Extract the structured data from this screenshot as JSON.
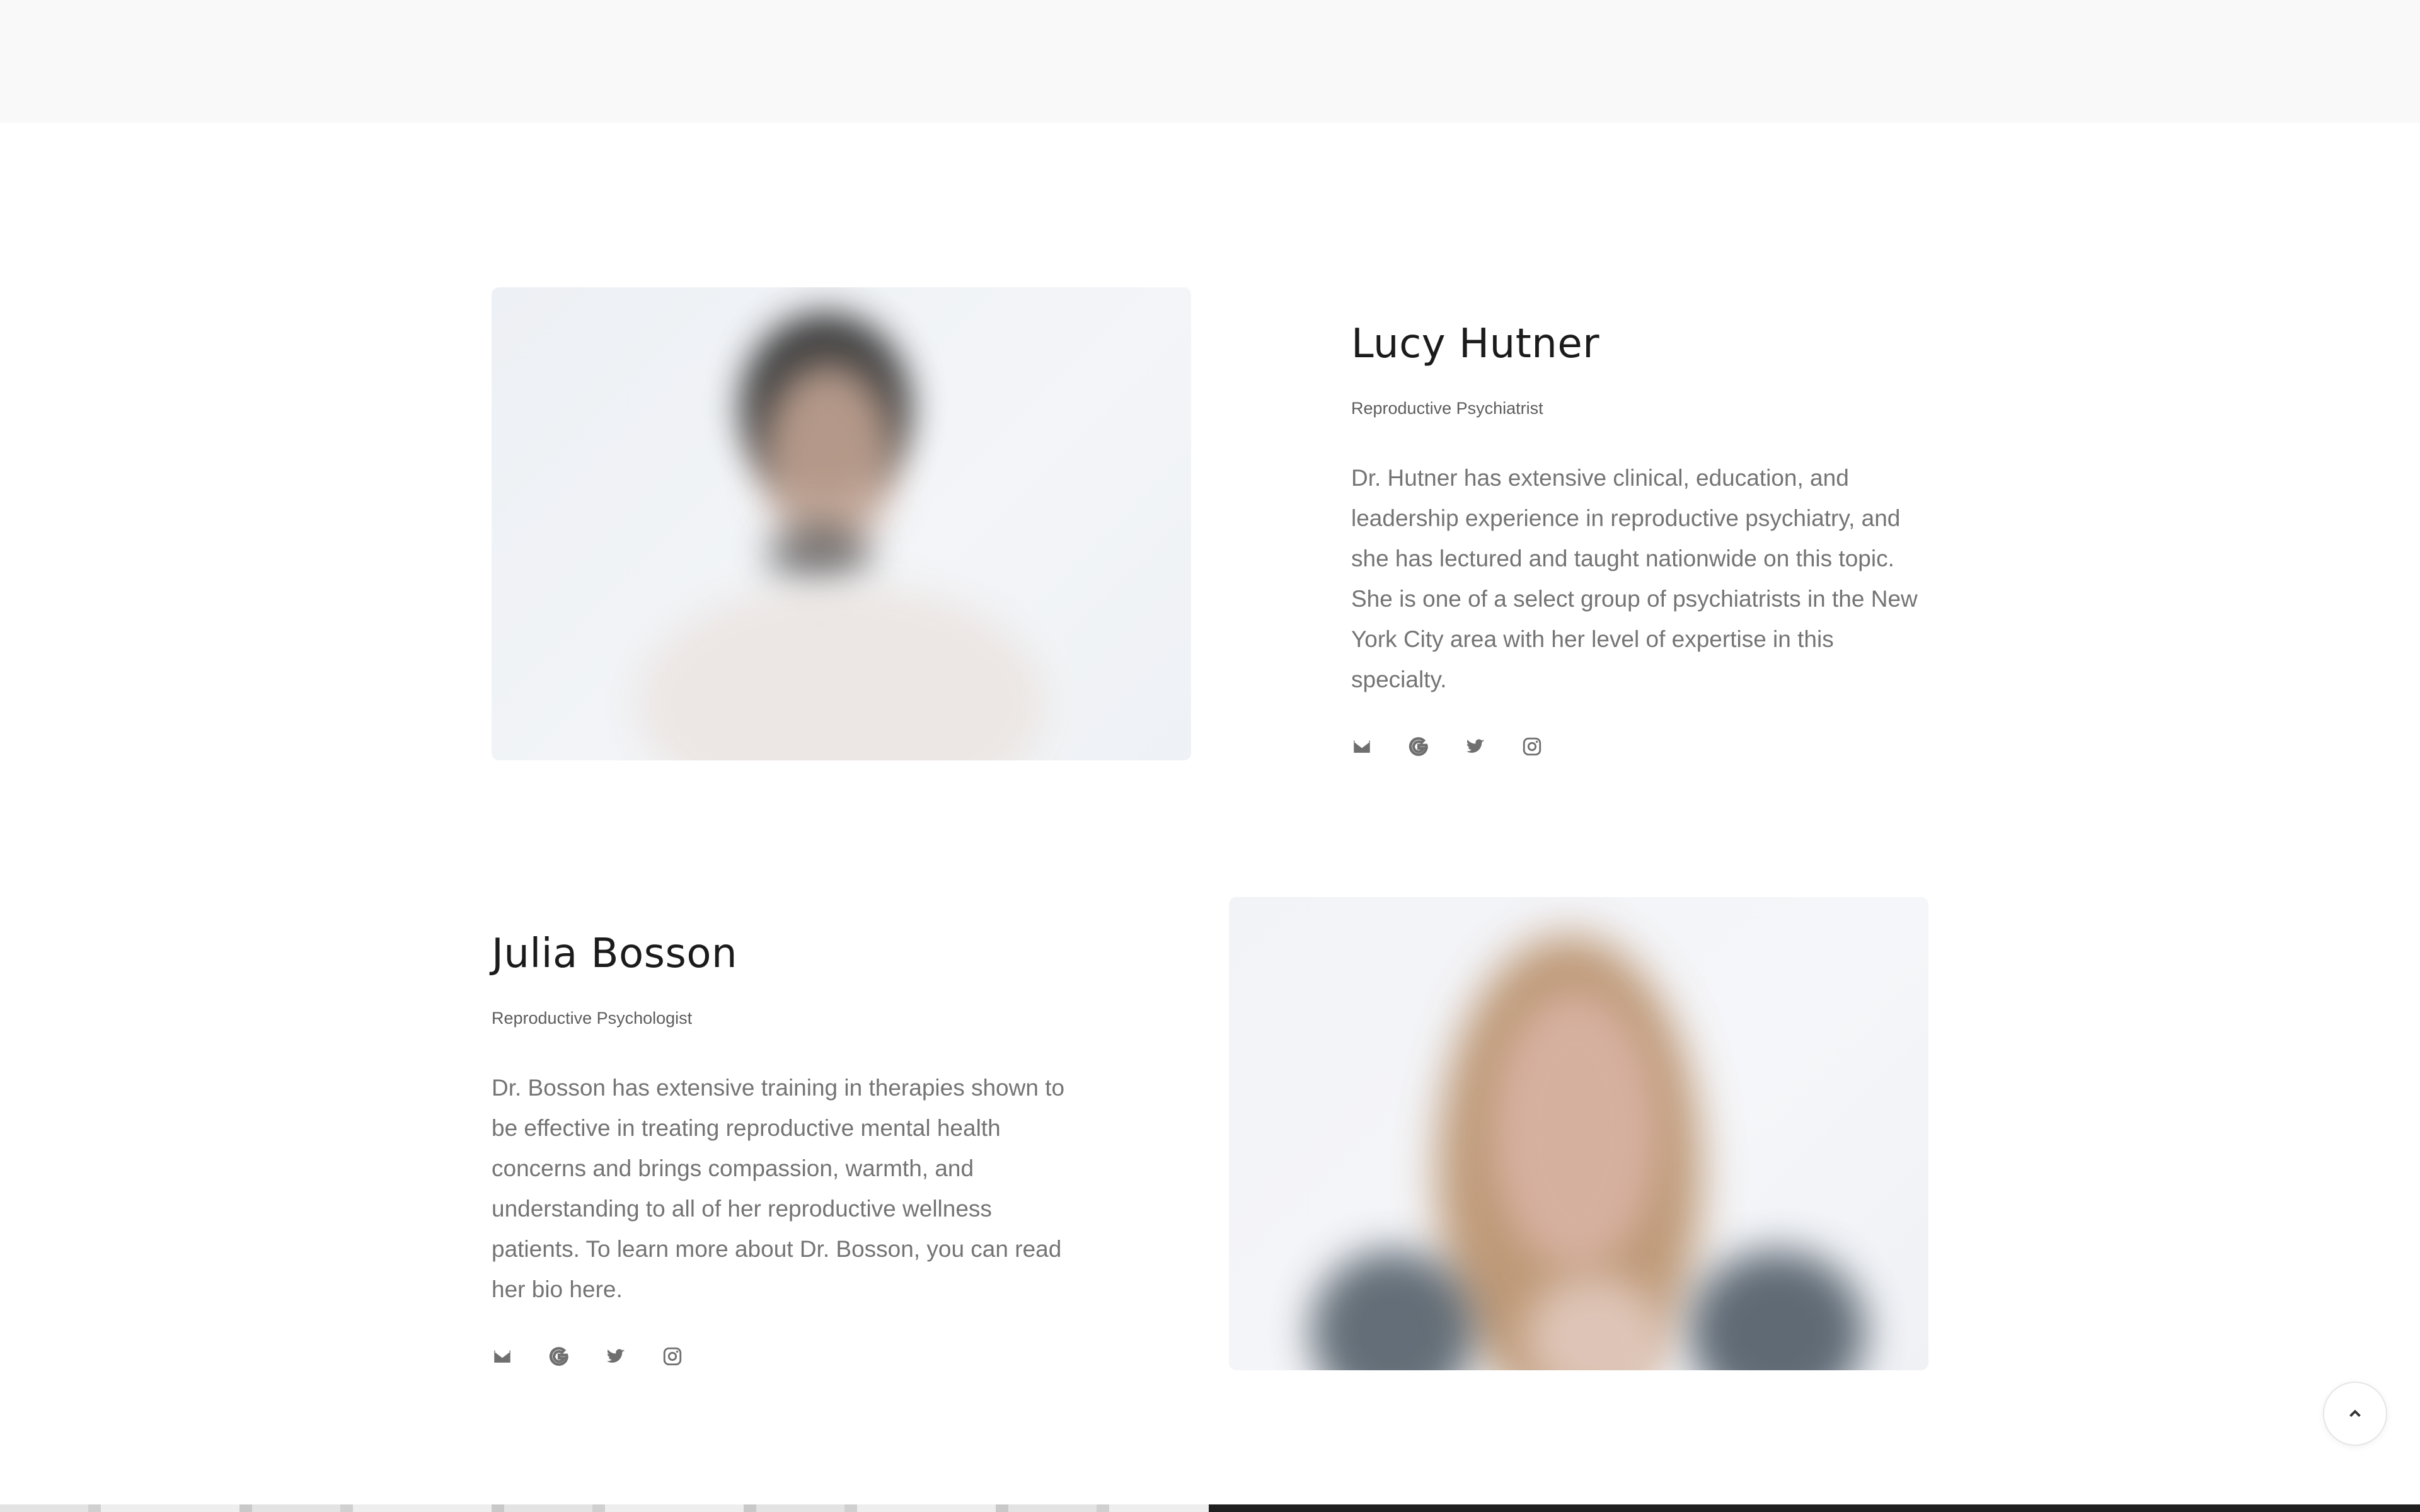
{
  "team": [
    {
      "name": "Lucy Hutner",
      "role": "Reproductive Psychiatrist",
      "bio": "Dr. Hutner has extensive clinical, education, and leadership experience in reproductive psychiatry, and she has lectured and taught nationwide on this topic. She is one of a select group of psychiatrists in the New York City area with her level of expertise in this specialty.",
      "socials": [
        "mail-icon",
        "google-icon",
        "twitter-icon",
        "instagram-icon"
      ]
    },
    {
      "name": "Julia Bosson",
      "role": "Reproductive Psychologist",
      "bio": "Dr. Bosson has extensive training in therapies shown to be effective in treating reproductive mental health concerns and brings compassion, warmth, and understanding to all of her reproductive wellness patients. To learn more about Dr. Bosson, you can read her bio here.",
      "socials": [
        "mail-icon",
        "google-icon",
        "twitter-icon",
        "instagram-icon"
      ]
    }
  ],
  "scroll_top_icon": "chevron-up-icon",
  "colors": {
    "top_band": "#f9f9f9",
    "name_text": "#1b1b1b",
    "body_text": "#747474",
    "icon": "#6f6f6f"
  }
}
